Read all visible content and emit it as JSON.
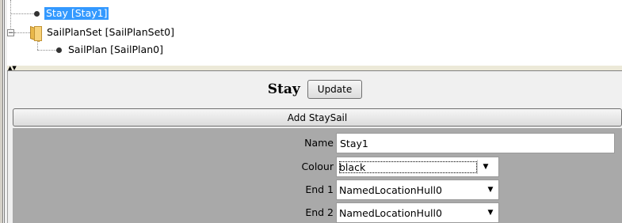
{
  "tree": {
    "items": [
      {
        "label": "Stay [Stay1]",
        "selected": true
      },
      {
        "label": "SailPlanSet [SailPlanSet0]",
        "expander": "−"
      },
      {
        "label": "SailPlan [SailPlan0]"
      }
    ]
  },
  "splitter": {
    "arrows": "▲▼"
  },
  "panel": {
    "title": "Stay",
    "update_label": "Update",
    "add_label": "Add StaySail",
    "fields": {
      "name": {
        "label": "Name",
        "value": "Stay1"
      },
      "colour": {
        "label": "Colour",
        "value": "black"
      },
      "end1": {
        "label": "End 1",
        "value": "NamedLocationHull0"
      },
      "end2": {
        "label": "End 2",
        "value": "NamedLocationHull0"
      }
    }
  },
  "icons": {
    "folder": "folder-icon",
    "node": "node-bullet-icon",
    "dropdown": "chevron-down-icon"
  },
  "colors": {
    "selection": "#3399ff",
    "form_background": "#a9a9a9",
    "panel_background": "#f0f0f0"
  }
}
